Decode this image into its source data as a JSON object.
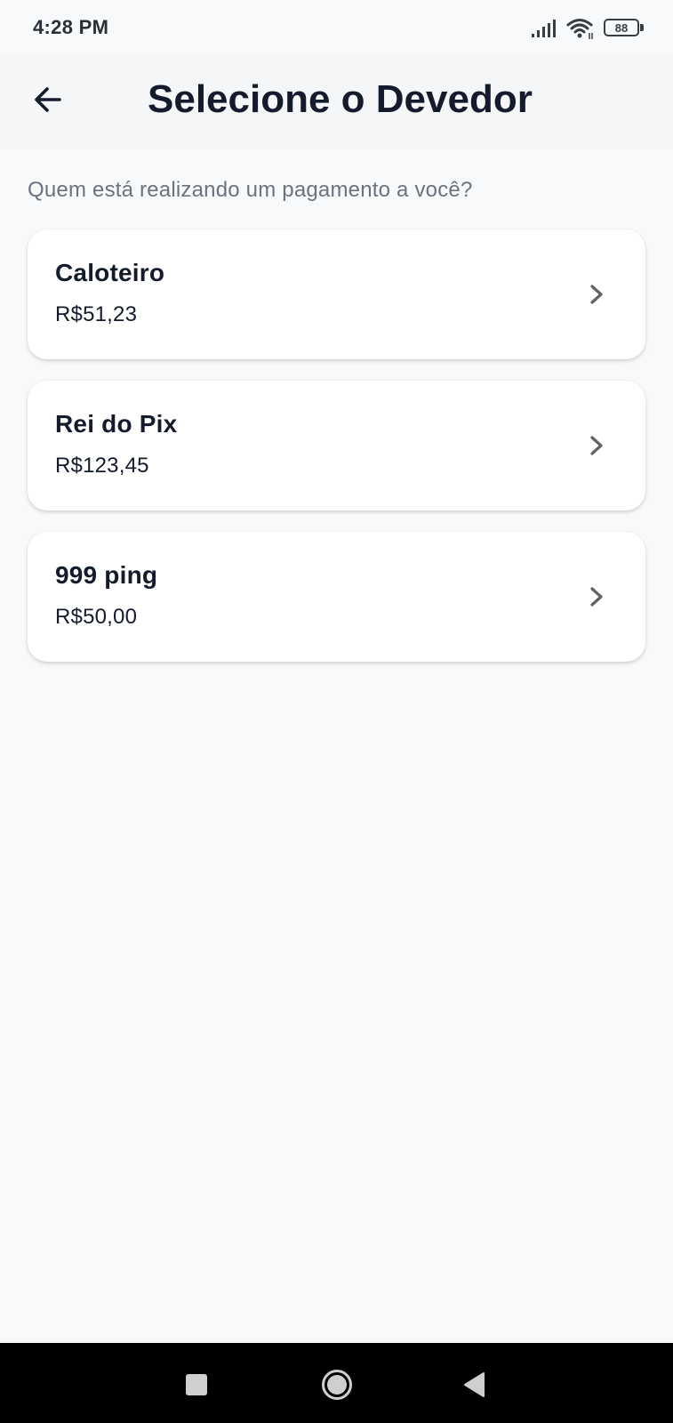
{
  "status_bar": {
    "time": "4:28 PM",
    "battery": "88"
  },
  "app_bar": {
    "title": "Selecione o Devedor",
    "back_icon": "arrow-left-icon"
  },
  "subtitle": "Quem está realizando um pagamento a você?",
  "debtors": [
    {
      "name": "Caloteiro",
      "amount": "R$51,23"
    },
    {
      "name": "Rei do Pix",
      "amount": "R$123,45"
    },
    {
      "name": "999 ping",
      "amount": "R$50,00"
    }
  ],
  "nav_bar": {
    "recents_icon": "square-icon",
    "home_icon": "circle-icon",
    "back_icon": "triangle-back-icon"
  },
  "colors": {
    "background": "#f8f9fb",
    "card": "#ffffff",
    "title": "#141b2d",
    "subtitle": "#6b7280",
    "chevron": "#5f6368"
  }
}
